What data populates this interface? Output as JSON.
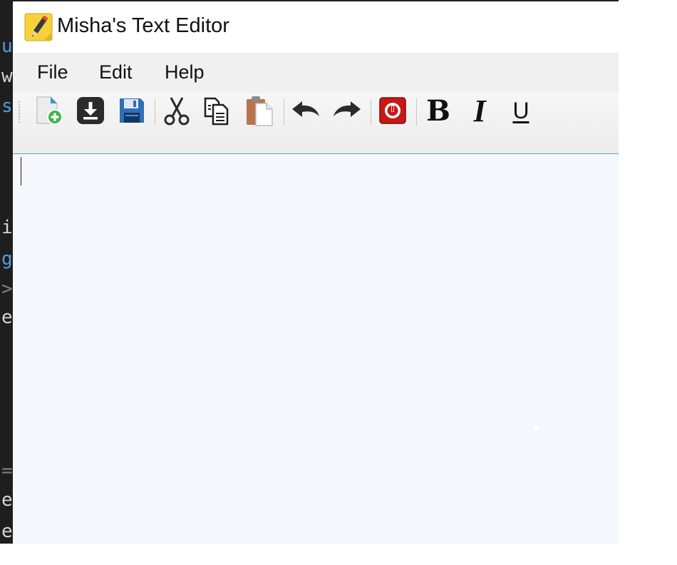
{
  "window": {
    "title": "Misha's Text Editor"
  },
  "menu": [
    {
      "name": "menu-file",
      "label": "File"
    },
    {
      "name": "menu-edit",
      "label": "Edit"
    },
    {
      "name": "menu-help",
      "label": "Help"
    }
  ],
  "toolbar": {
    "buttons": [
      {
        "name": "new-button",
        "icon": "new-document-icon"
      },
      {
        "name": "open-button",
        "icon": "download-icon"
      },
      {
        "name": "save-button",
        "icon": "floppy-disk-icon"
      },
      {
        "name": "cut-button",
        "icon": "scissors-icon"
      },
      {
        "name": "copy-button",
        "icon": "copy-icon"
      },
      {
        "name": "paste-button",
        "icon": "clipboard-icon"
      },
      {
        "name": "undo-button",
        "icon": "undo-arrow-icon"
      },
      {
        "name": "redo-button",
        "icon": "redo-arrow-icon"
      },
      {
        "name": "exit-button",
        "icon": "power-icon"
      }
    ],
    "format": {
      "bold": "B",
      "italic": "I",
      "underline": "U"
    }
  },
  "editor": {
    "text": ""
  },
  "background_code": [
    "u",
    "w",
    "s",
    "i",
    "g",
    ">",
    "e",
    "=",
    "e",
    "e"
  ],
  "colors": {
    "accent": "#5aa0c8",
    "editor_background": "#f4f7fb",
    "toolbar_background": "#f0f0f0",
    "code_background": "#1e1e1e",
    "code_keyword": "#569cd6",
    "code_text": "#d4d4d4"
  }
}
